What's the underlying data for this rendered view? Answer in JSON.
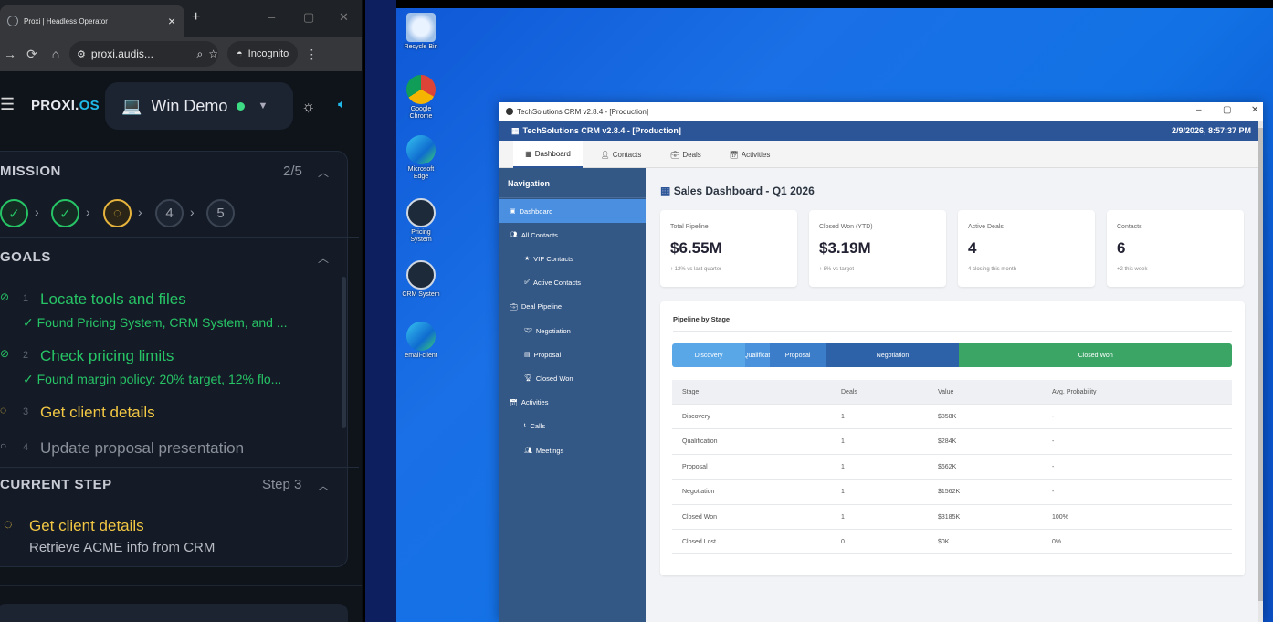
{
  "browser": {
    "tab_title": "Proxi | Headless Operator",
    "address": "proxi.audis...",
    "incognito_label": "Incognito"
  },
  "app": {
    "brand_main": "PROXI.",
    "brand_os": "OS",
    "session_name": "Win Demo",
    "session_status_color": "#3ddc84"
  },
  "mission": {
    "title": "MISSION",
    "progress": "2/5",
    "steps": [
      {
        "label": "✓",
        "state": "done"
      },
      {
        "label": "✓",
        "state": "done"
      },
      {
        "label": "◌",
        "state": "current"
      },
      {
        "label": "4",
        "state": "todo"
      },
      {
        "label": "5",
        "state": "todo"
      }
    ]
  },
  "goals": {
    "title": "GOALS",
    "items": [
      {
        "num": "1",
        "title": "Locate tools and files",
        "sub": "✓ Found Pricing System, CRM System, and ...",
        "state": "done"
      },
      {
        "num": "2",
        "title": "Check pricing limits",
        "sub": "✓ Found margin policy: 20% target, 12% flo...",
        "state": "done"
      },
      {
        "num": "3",
        "title": "Get client details",
        "sub": "",
        "state": "current"
      },
      {
        "num": "4",
        "title": "Update proposal presentation",
        "sub": "",
        "state": "todo"
      }
    ]
  },
  "current_step": {
    "title": "CURRENT STEP",
    "step_label": "Step 3",
    "name": "Get client details",
    "description": "Retrieve ACME info from CRM"
  },
  "desktop_icons": [
    {
      "label": "Recycle Bin",
      "icon": "recycle-bin-icon"
    },
    {
      "label": "Google Chrome",
      "icon": "chrome-icon"
    },
    {
      "label": "Microsoft Edge",
      "icon": "edge-icon"
    },
    {
      "label": "Pricing System",
      "icon": "pricing-system-icon"
    },
    {
      "label": "CRM System",
      "icon": "crm-system-icon"
    },
    {
      "label": "email-client",
      "icon": "email-client-icon"
    }
  ],
  "crm": {
    "window_title": "TechSolutions CRM v2.8.4 - [Production]",
    "header_title": "TechSolutions CRM v2.8.4 - [Production]",
    "datetime": "2/9/2026, 8:57:37 PM",
    "tabs": [
      "Dashboard",
      "Contacts",
      "Deals",
      "Activities"
    ],
    "nav_heading": "Navigation",
    "nav_items": [
      {
        "label": "Dashboard",
        "level": 0
      },
      {
        "label": "All Contacts",
        "level": 0
      },
      {
        "label": "VIP Contacts",
        "level": 1
      },
      {
        "label": "Active Contacts",
        "level": 1
      },
      {
        "label": "Deal Pipeline",
        "level": 0
      },
      {
        "label": "Negotiation",
        "level": 1
      },
      {
        "label": "Proposal",
        "level": 1
      },
      {
        "label": "Closed Won",
        "level": 1
      },
      {
        "label": "Activities",
        "level": 0
      },
      {
        "label": "Calls",
        "level": 1
      },
      {
        "label": "Meetings",
        "level": 1
      }
    ],
    "dashboard_title": "Sales Dashboard - Q1 2026",
    "kpis": [
      {
        "label": "Total Pipeline",
        "value": "$6.55M",
        "sub": "↑ 12% vs last quarter"
      },
      {
        "label": "Closed Won (YTD)",
        "value": "$3.19M",
        "sub": "↑ 8% vs target"
      },
      {
        "label": "Active Deals",
        "value": "4",
        "sub": "4 closing this month"
      },
      {
        "label": "Contacts",
        "value": "6",
        "sub": "+2 this week"
      }
    ],
    "pipeline_title": "Pipeline by Stage",
    "pipeline_segments": [
      {
        "label": "Discovery",
        "share": 0.131,
        "color": "#5aa7e8"
      },
      {
        "label": "Qualificati",
        "share": 0.043,
        "color": "#4a93dc"
      },
      {
        "label": "Proposal",
        "share": 0.101,
        "color": "#3b7dc8"
      },
      {
        "label": "Negotiation",
        "share": 0.238,
        "color": "#2d62a8"
      },
      {
        "label": "Closed Won",
        "share": 0.487,
        "color": "#3aa565"
      }
    ],
    "table_headers": [
      "Stage",
      "Deals",
      "Value",
      "Avg. Probability"
    ],
    "table_rows": [
      [
        "Discovery",
        "1",
        "$858K",
        "-"
      ],
      [
        "Qualification",
        "1",
        "$284K",
        "-"
      ],
      [
        "Proposal",
        "1",
        "$662K",
        "-"
      ],
      [
        "Negotiation",
        "1",
        "$1562K",
        "-"
      ],
      [
        "Closed Won",
        "1",
        "$3185K",
        "100%"
      ],
      [
        "Closed Lost",
        "0",
        "$0K",
        "0%"
      ]
    ]
  }
}
